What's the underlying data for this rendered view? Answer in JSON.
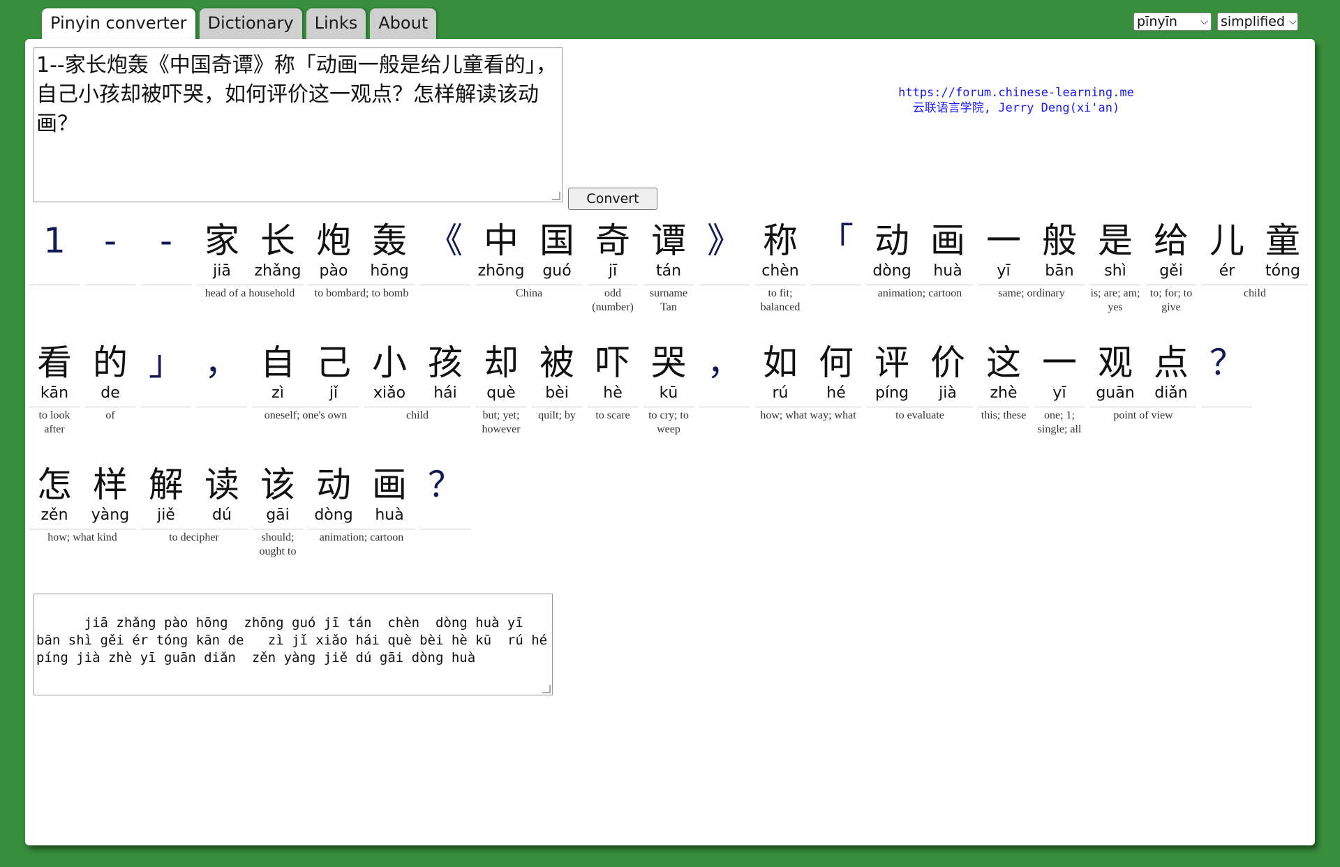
{
  "tabs": [
    {
      "label": "Pinyin converter",
      "active": true
    },
    {
      "label": "Dictionary",
      "active": false
    },
    {
      "label": "Links",
      "active": false
    },
    {
      "label": "About",
      "active": false
    }
  ],
  "selects": {
    "mode": "pīnyīn",
    "script": "simplified"
  },
  "input_text": "1--家长炮轰《中国奇谭》称「动画一般是给儿童看的」，自己小孩却被吓哭，如何评价这一观点？怎样解读该动画？",
  "convert_label": "Convert",
  "link": {
    "url": "https://forum.chinese-learning.me",
    "credit": "云联语言学院, Jerry Deng(xi'an)"
  },
  "rows": [
    [
      {
        "chars": [
          {
            "h": "1",
            "p": "",
            "punct": true
          }
        ],
        "gloss": ""
      },
      {
        "chars": [
          {
            "h": "-",
            "p": "",
            "punct": true
          }
        ],
        "gloss": ""
      },
      {
        "chars": [
          {
            "h": "-",
            "p": "",
            "punct": true
          }
        ],
        "gloss": ""
      },
      {
        "chars": [
          {
            "h": "家",
            "p": "jiā"
          },
          {
            "h": "长",
            "p": "zhǎng"
          }
        ],
        "gloss": "head of a household"
      },
      {
        "chars": [
          {
            "h": "炮",
            "p": "pào"
          },
          {
            "h": "轰",
            "p": "hōng"
          }
        ],
        "gloss": "to bombard; to bomb"
      },
      {
        "chars": [
          {
            "h": "《",
            "p": "",
            "punct": true
          }
        ],
        "gloss": ""
      },
      {
        "chars": [
          {
            "h": "中",
            "p": "zhōng"
          },
          {
            "h": "国",
            "p": "guó"
          }
        ],
        "gloss": "China"
      },
      {
        "chars": [
          {
            "h": "奇",
            "p": "jī"
          }
        ],
        "gloss": "odd (number)"
      },
      {
        "chars": [
          {
            "h": "谭",
            "p": "tán"
          }
        ],
        "gloss": "surname Tan"
      },
      {
        "chars": [
          {
            "h": "》",
            "p": "",
            "punct": true
          }
        ],
        "gloss": ""
      },
      {
        "chars": [
          {
            "h": "称",
            "p": "chèn"
          }
        ],
        "gloss": "to fit; balanced"
      },
      {
        "chars": [
          {
            "h": "「",
            "p": "",
            "punct": true
          }
        ],
        "gloss": ""
      },
      {
        "chars": [
          {
            "h": "动",
            "p": "dòng"
          },
          {
            "h": "画",
            "p": "huà"
          }
        ],
        "gloss": "animation; cartoon"
      },
      {
        "chars": [
          {
            "h": "一",
            "p": "yī"
          },
          {
            "h": "般",
            "p": "bān"
          }
        ],
        "gloss": "same; ordinary"
      },
      {
        "chars": [
          {
            "h": "是",
            "p": "shì"
          }
        ],
        "gloss": "is; are; am; yes"
      },
      {
        "chars": [
          {
            "h": "给",
            "p": "gěi"
          }
        ],
        "gloss": "to; for; to give"
      },
      {
        "chars": [
          {
            "h": "儿",
            "p": "ér"
          },
          {
            "h": "童",
            "p": "tóng"
          }
        ],
        "gloss": "child"
      }
    ],
    [
      {
        "chars": [
          {
            "h": "看",
            "p": "kān"
          }
        ],
        "gloss": "to look after"
      },
      {
        "chars": [
          {
            "h": "的",
            "p": "de"
          }
        ],
        "gloss": "of"
      },
      {
        "chars": [
          {
            "h": "」",
            "p": "",
            "punct": true
          }
        ],
        "gloss": ""
      },
      {
        "chars": [
          {
            "h": "，",
            "p": "",
            "punct": true
          }
        ],
        "gloss": ""
      },
      {
        "chars": [
          {
            "h": "自",
            "p": "zì"
          },
          {
            "h": "己",
            "p": "jǐ"
          }
        ],
        "gloss": "oneself; one's own"
      },
      {
        "chars": [
          {
            "h": "小",
            "p": "xiǎo"
          },
          {
            "h": "孩",
            "p": "hái"
          }
        ],
        "gloss": "child"
      },
      {
        "chars": [
          {
            "h": "却",
            "p": "què"
          }
        ],
        "gloss": "but; yet; however"
      },
      {
        "chars": [
          {
            "h": "被",
            "p": "bèi"
          }
        ],
        "gloss": "quilt; by"
      },
      {
        "chars": [
          {
            "h": "吓",
            "p": "hè"
          }
        ],
        "gloss": "to scare"
      },
      {
        "chars": [
          {
            "h": "哭",
            "p": "kū"
          }
        ],
        "gloss": "to cry; to weep"
      },
      {
        "chars": [
          {
            "h": "，",
            "p": "",
            "punct": true
          }
        ],
        "gloss": ""
      },
      {
        "chars": [
          {
            "h": "如",
            "p": "rú"
          },
          {
            "h": "何",
            "p": "hé"
          }
        ],
        "gloss": "how; what way; what"
      },
      {
        "chars": [
          {
            "h": "评",
            "p": "píng"
          },
          {
            "h": "价",
            "p": "jià"
          }
        ],
        "gloss": "to evaluate"
      },
      {
        "chars": [
          {
            "h": "这",
            "p": "zhè"
          }
        ],
        "gloss": "this; these"
      },
      {
        "chars": [
          {
            "h": "一",
            "p": "yī"
          }
        ],
        "gloss": "one; 1; single; all"
      },
      {
        "chars": [
          {
            "h": "观",
            "p": "guān"
          },
          {
            "h": "点",
            "p": "diǎn"
          }
        ],
        "gloss": "point of view"
      },
      {
        "chars": [
          {
            "h": "？",
            "p": "",
            "punct": true
          }
        ],
        "gloss": ""
      }
    ],
    [
      {
        "chars": [
          {
            "h": "怎",
            "p": "zěn"
          },
          {
            "h": "样",
            "p": "yàng"
          }
        ],
        "gloss": "how; what kind"
      },
      {
        "chars": [
          {
            "h": "解",
            "p": "jiě"
          },
          {
            "h": "读",
            "p": "dú"
          }
        ],
        "gloss": "to decipher"
      },
      {
        "chars": [
          {
            "h": "该",
            "p": "gāi"
          }
        ],
        "gloss": "should; ought to"
      },
      {
        "chars": [
          {
            "h": "动",
            "p": "dòng"
          },
          {
            "h": "画",
            "p": "huà"
          }
        ],
        "gloss": "animation; cartoon"
      },
      {
        "chars": [
          {
            "h": "？",
            "p": "",
            "punct": true
          }
        ],
        "gloss": ""
      }
    ]
  ],
  "output_text": "  jiā zhǎng pào hōng  zhōng guó jī tán  chèn  dòng huà yī bān shì gěi ér tóng kān de   zì jǐ xiǎo hái què bèi hè kū  rú hé píng jià zhè yī guān diǎn  zěn yàng jiě dú gāi dòng huà"
}
